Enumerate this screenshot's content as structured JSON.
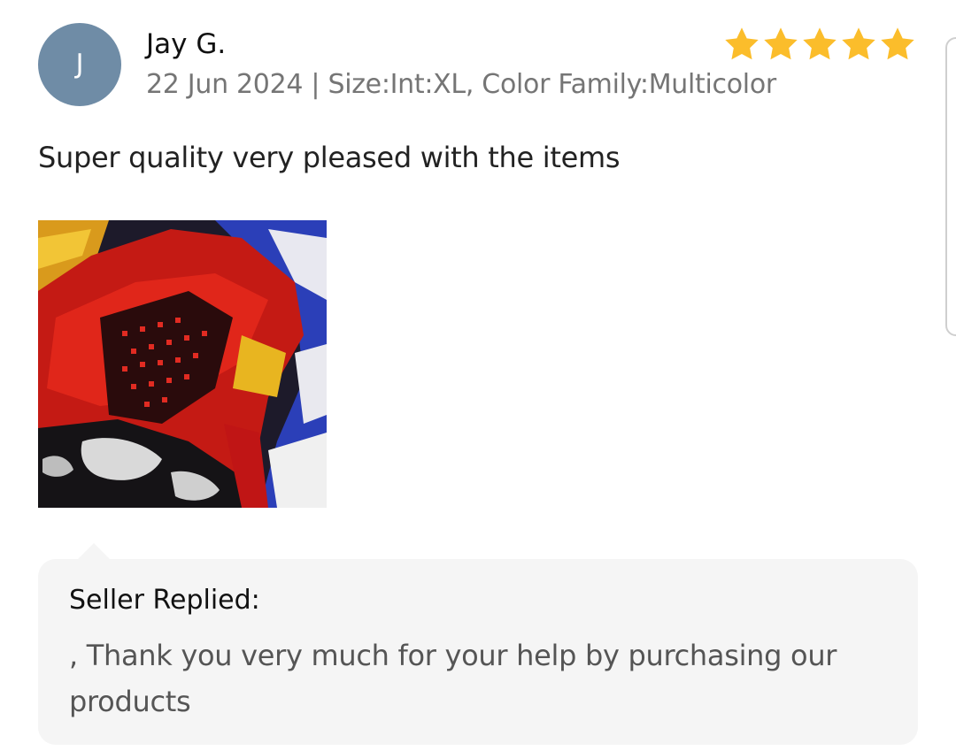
{
  "review": {
    "avatar_initial": "J",
    "reviewer_name": "Jay G.",
    "meta": "22 Jun 2024 | Size:Int:XL, Color Family:Multicolor",
    "rating": 5,
    "rating_max": 5,
    "star_color": "#fbbd2b",
    "text": "Super quality very pleased with the items",
    "photo_icon": "product-photo"
  },
  "seller_reply": {
    "title": "Seller Replied:",
    "text": ", Thank you very much for your help by purchasing our products"
  }
}
